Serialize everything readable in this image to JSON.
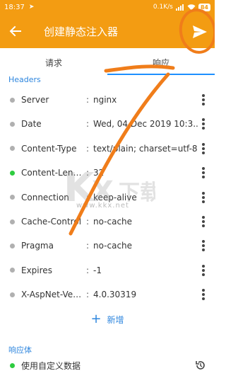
{
  "status_bar": {
    "time": "18:37",
    "speed": "0.1K/s",
    "battery": "84"
  },
  "app_bar": {
    "title": "创建静态注入器",
    "back_icon": "arrow-left-icon",
    "send_icon": "send-icon"
  },
  "tabs": [
    {
      "label": "请求",
      "active": false
    },
    {
      "label": "响应",
      "active": true
    }
  ],
  "headers": {
    "section_label": "Headers",
    "rows": [
      {
        "key": "Server",
        "value": "nginx",
        "enabled": false
      },
      {
        "key": "Date",
        "value": "Wed, 04 Dec 2019 10:3...",
        "enabled": false
      },
      {
        "key": "Content-Type",
        "value": "text/plain; charset=utf-8",
        "enabled": false
      },
      {
        "key": "Content-Length",
        "value": "32",
        "enabled": true
      },
      {
        "key": "Connection",
        "value": "keep-alive",
        "enabled": false
      },
      {
        "key": "Cache-Control",
        "value": "no-cache",
        "enabled": false
      },
      {
        "key": "Pragma",
        "value": "no-cache",
        "enabled": false
      },
      {
        "key": "Expires",
        "value": "-1",
        "enabled": false
      },
      {
        "key": "X-AspNet-Ver...",
        "value": "4.0.30319",
        "enabled": false
      }
    ],
    "add_label": "新增"
  },
  "response_body": {
    "section_label": "响应体",
    "option_label": "使用自定义数据",
    "enabled": true
  },
  "watermark": {
    "url": "www.kkx.net"
  },
  "colors": {
    "primary": "#f39c12",
    "accent": "#2e86de",
    "enabled_dot": "#2ecc40",
    "disabled_dot": "#b0b0b0"
  }
}
